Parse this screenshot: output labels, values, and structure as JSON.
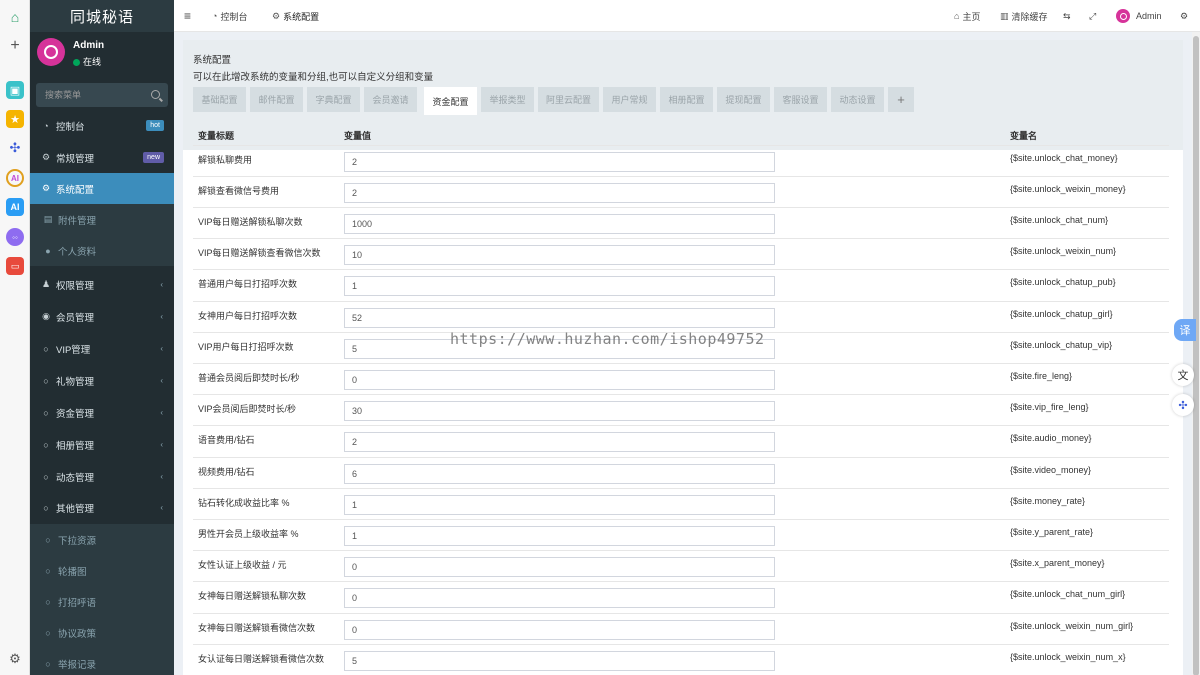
{
  "sidebar": {
    "logo": "同城秘语",
    "user": {
      "name": "Admin",
      "status": "在线"
    },
    "search_placeholder": "搜索菜单",
    "items": [
      {
        "label": "控制台",
        "icon": "dashboard-icon",
        "badge": "hot"
      },
      {
        "label": "常规管理",
        "icon": "cogs-icon",
        "badge": "new"
      },
      {
        "label": "系统配置",
        "icon": "gear-icon",
        "active": true
      },
      {
        "label": "附件管理",
        "icon": "file-image-icon"
      },
      {
        "label": "个人资料",
        "icon": "user-icon"
      },
      {
        "label": "权限管理",
        "icon": "group-icon"
      },
      {
        "label": "会员管理",
        "icon": "user-circle-icon"
      },
      {
        "label": "VIP管理",
        "icon": "circle-icon"
      },
      {
        "label": "礼物管理",
        "icon": "circle-icon"
      },
      {
        "label": "资金管理",
        "icon": "circle-icon"
      },
      {
        "label": "相册管理",
        "icon": "circle-icon"
      },
      {
        "label": "动态管理",
        "icon": "circle-icon"
      },
      {
        "label": "其他管理",
        "icon": "circle-icon"
      },
      {
        "label": "下拉资源",
        "icon": "circle-icon"
      },
      {
        "label": "轮播图",
        "icon": "circle-icon"
      },
      {
        "label": "打招呼语",
        "icon": "circle-icon"
      },
      {
        "label": "协议政策",
        "icon": "circle-icon"
      },
      {
        "label": "举报记录",
        "icon": "circle-icon"
      }
    ]
  },
  "navbar": {
    "tab_dashboard": "控制台",
    "tab_config": "系统配置",
    "home": "主页",
    "clear_cache": "清除缓存",
    "admin": "Admin"
  },
  "page": {
    "title": "系统配置",
    "description": "可以在此增改系统的变量和分组,也可以自定义分组和变量",
    "tabs": [
      "基础配置",
      "邮件配置",
      "字典配置",
      "会员邀请",
      "资金配置",
      "举报类型",
      "阿里云配置",
      "用户常规",
      "相册配置",
      "提现配置",
      "客服设置",
      "动态设置",
      "+"
    ],
    "active_tab": "资金配置"
  },
  "table": {
    "headers": [
      "变量标题",
      "变量值",
      "变量名"
    ],
    "rows": [
      {
        "title": "解锁私聊费用",
        "value": "2",
        "key": "{$site.unlock_chat_money}"
      },
      {
        "title": "解锁查看微信号费用",
        "value": "2",
        "key": "{$site.unlock_weixin_money}"
      },
      {
        "title": "VIP每日赠送解锁私聊次数",
        "value": "1000",
        "key": "{$site.unlock_chat_num}"
      },
      {
        "title": "VIP每日赠送解锁查看微信次数",
        "value": "10",
        "key": "{$site.unlock_weixin_num}"
      },
      {
        "title": "普通用户每日打招呼次数",
        "value": "1",
        "key": "{$site.unlock_chatup_pub}"
      },
      {
        "title": "女神用户每日打招呼次数",
        "value": "52",
        "key": "{$site.unlock_chatup_girl}"
      },
      {
        "title": "VIP用户每日打招呼次数",
        "value": "5",
        "key": "{$site.unlock_chatup_vip}"
      },
      {
        "title": "普通会员阅后即焚时长/秒",
        "value": "0",
        "key": "{$site.fire_leng}"
      },
      {
        "title": "VIP会员阅后即焚时长/秒",
        "value": "30",
        "key": "{$site.vip_fire_leng}"
      },
      {
        "title": "语音费用/钻石",
        "value": "2",
        "key": "{$site.audio_money}"
      },
      {
        "title": "视频费用/钻石",
        "value": "6",
        "key": "{$site.video_money}"
      },
      {
        "title": "钻石转化成收益比率 %",
        "value": "1",
        "key": "{$site.money_rate}"
      },
      {
        "title": "男性开会员上级收益率 %",
        "value": "1",
        "key": "{$site.y_parent_rate}"
      },
      {
        "title": "女性认证上级收益 / 元",
        "value": "0",
        "key": "{$site.x_parent_money}"
      },
      {
        "title": "女神每日赠送解锁私聊次数",
        "value": "0",
        "key": "{$site.unlock_chat_num_girl}"
      },
      {
        "title": "女神每日赠送解锁看微信次数",
        "value": "0",
        "key": "{$site.unlock_weixin_num_girl}"
      },
      {
        "title": "女认证每日赠送解锁看微信次数",
        "value": "5",
        "key": "{$site.unlock_weixin_num_x}"
      }
    ]
  },
  "right_widgets": {
    "translate": "译"
  },
  "watermark": "https://www.huzhan.com/ishop49752",
  "colors": {
    "sidebar_bg": "#222d32",
    "active": "#3c8dbc",
    "avatar": "#d6339a",
    "online": "#00a65a"
  }
}
